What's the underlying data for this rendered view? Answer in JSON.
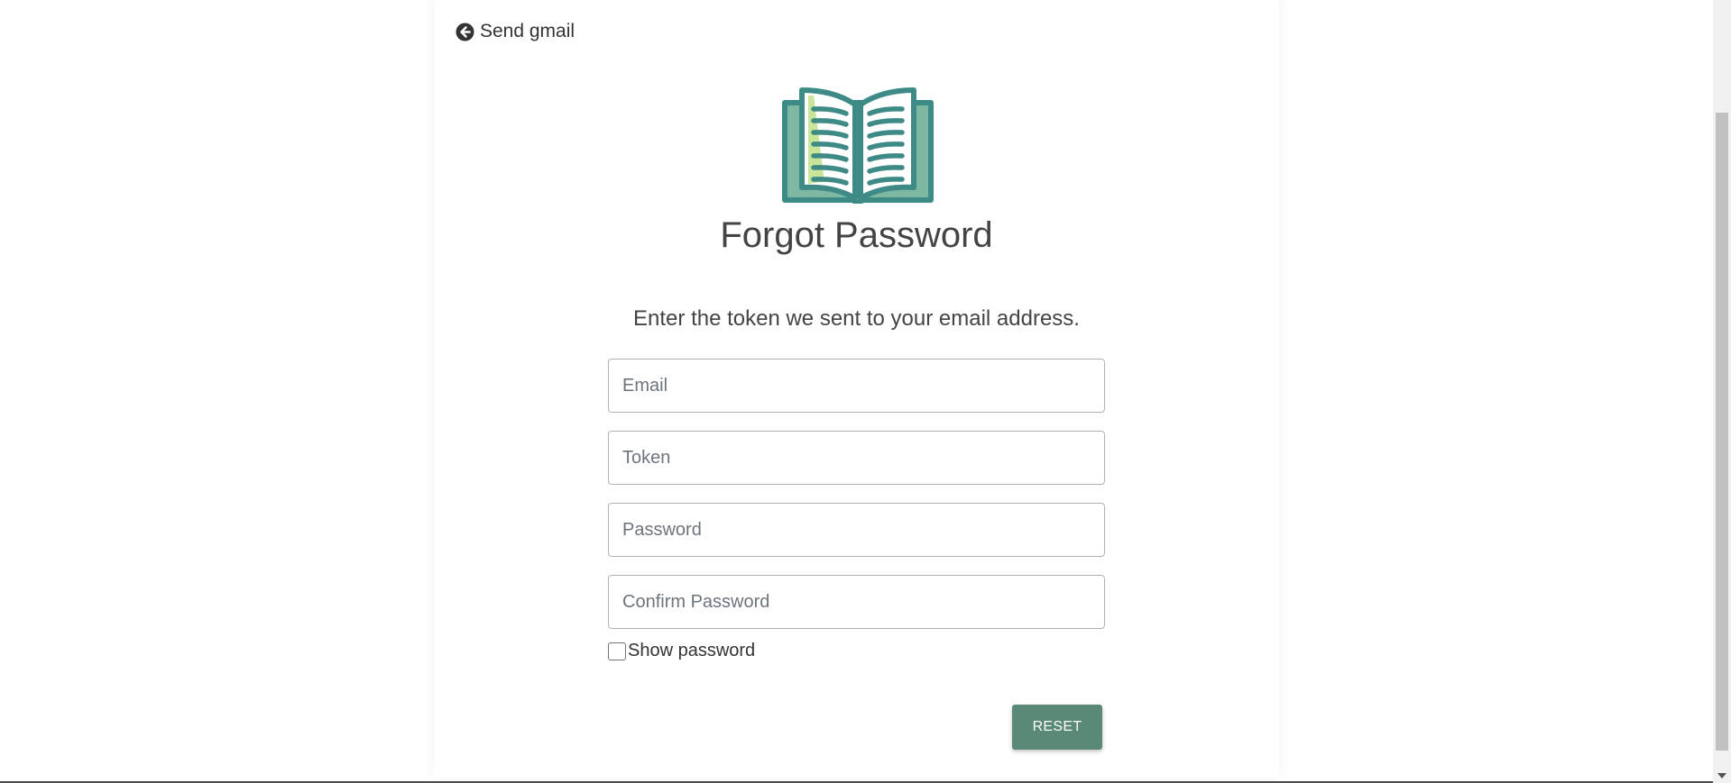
{
  "nav": {
    "back_label": "Send gmail",
    "back_icon": "arrow-circle-left-icon"
  },
  "logo": {
    "icon": "open-book-icon",
    "colors": {
      "teal": "#3e8a87",
      "light_green": "#c9e59a",
      "mid_green": "#7fb8a2"
    }
  },
  "page": {
    "title": "Forgot Password",
    "instruction": "Enter the token we sent to your email address."
  },
  "form": {
    "email_placeholder": "Email",
    "token_placeholder": "Token",
    "password_placeholder": "Password",
    "confirm_password_placeholder": "Confirm Password",
    "show_password_label": "Show password",
    "show_password_checked": false,
    "reset_label": "RESET"
  },
  "colors": {
    "button_bg": "#5a8a77",
    "text": "#444444",
    "border": "#b3b3b3"
  }
}
